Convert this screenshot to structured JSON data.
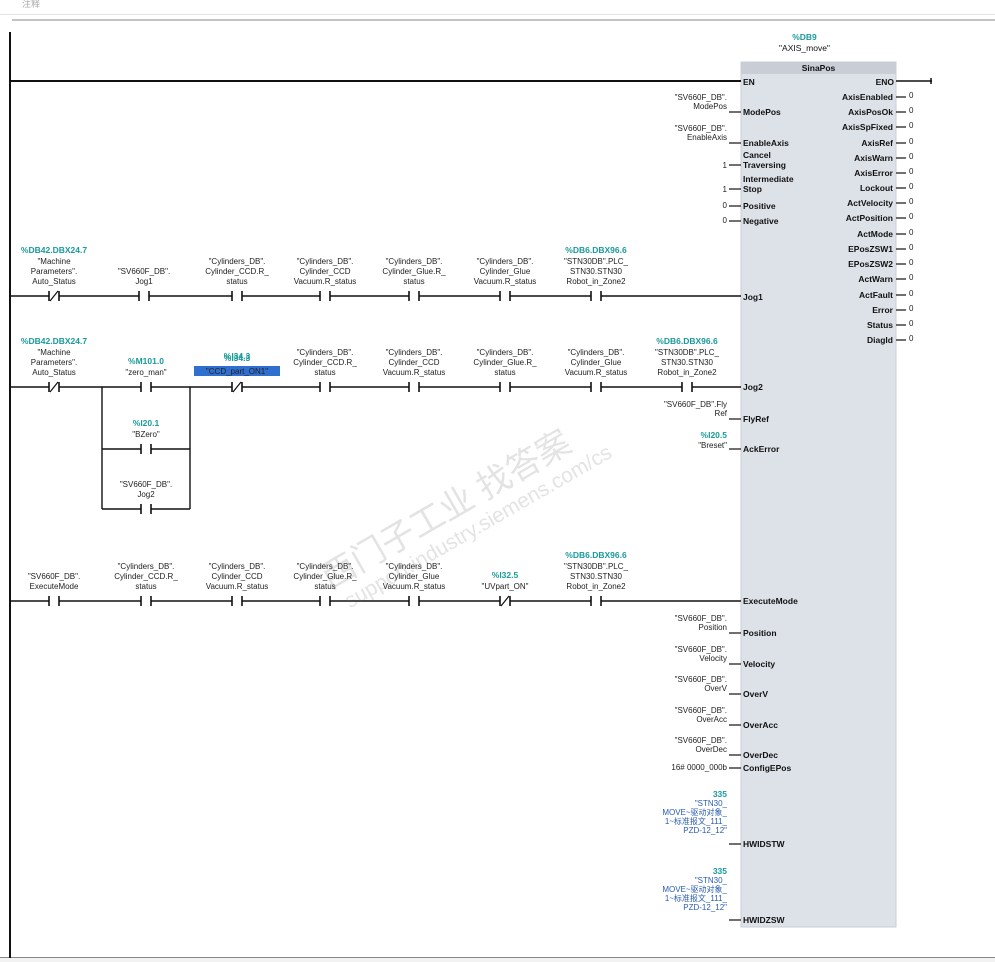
{
  "header": {
    "comment_label": "注释"
  },
  "block": {
    "db_address": "%DB9",
    "db_name": "\"AXIS_move\"",
    "type": "SinaPos",
    "en": "EN",
    "eno": "ENO",
    "left_pins": [
      "ModePos",
      "EnableAxis",
      "Cancel",
      "Traversing",
      "Intermediate",
      "Stop",
      "Positive",
      "Negative",
      "Jog1",
      "Jog2",
      "FlyRef",
      "AckError",
      "ExecuteMode",
      "Position",
      "Velocity",
      "OverV",
      "OverAcc",
      "OverDec",
      "ConfigEPos",
      "HWIDSTW",
      "HWIDZSW"
    ],
    "right_pins": [
      "AxisEnabled",
      "AxisPosOk",
      "AxisSpFixed",
      "AxisRef",
      "AxisWarn",
      "AxisError",
      "Lockout",
      "ActVelocity",
      "ActPosition",
      "ActMode",
      "EPosZSW1",
      "EPosZSW2",
      "ActWarn",
      "ActFault",
      "Error",
      "Status",
      "DiagId"
    ],
    "right_values": [
      "0",
      "0",
      "0",
      "0",
      "0",
      "0",
      "0",
      "0",
      "0",
      "0",
      "0",
      "0",
      "0",
      "0",
      "0",
      "0",
      "0"
    ]
  },
  "inputs": {
    "modepos": [
      "\"SV660F_DB\".",
      "ModePos"
    ],
    "enableaxis": [
      "\"SV660F_DB\".",
      "EnableAxis"
    ],
    "cancel_val": "1",
    "stop_val": "1",
    "positive_val": "0",
    "negative_val": "0",
    "flyref": [
      "\"SV660F_DB\".Fly",
      "Ref"
    ],
    "ackerror_addr": "%I20.5",
    "ackerror_name": "\"Breset\"",
    "position": [
      "\"SV660F_DB\".",
      "Position"
    ],
    "velocity": [
      "\"SV660F_DB\".",
      "Velocity"
    ],
    "overv": [
      "\"SV660F_DB\".",
      "OverV"
    ],
    "overacc": [
      "\"SV660F_DB\".",
      "OverAcc"
    ],
    "overdec": [
      "\"SV660F_DB\".",
      "OverDec"
    ],
    "configepos": "16# 0000_000b",
    "hwidstw": [
      "335",
      "\"STN30_",
      "MOVE~驱动对象_",
      "1~标准报文_111_",
      "PZD-12_12\""
    ],
    "hwidzsw": [
      "335",
      "\"STN30_",
      "MOVE~驱动对象_",
      "1~标准报文_111_",
      "PZD-12_12\""
    ]
  },
  "rung_jog1": [
    {
      "addr": "%DB42.DBX24.7",
      "lines": [
        "\"Machine",
        "Parameters\".",
        "Auto_Status"
      ],
      "type": "NC"
    },
    {
      "addr": "",
      "lines": [
        "\"SV660F_DB\".",
        "Jog1"
      ],
      "type": "NO"
    },
    {
      "addr": "",
      "lines": [
        "\"Cylinders_DB\".",
        "Cylinder_CCD.R_",
        "status"
      ],
      "type": "NO"
    },
    {
      "addr": "",
      "lines": [
        "\"Cylinders_DB\".",
        "Cylinder_CCD",
        "Vacuum.R_status"
      ],
      "type": "NO"
    },
    {
      "addr": "",
      "lines": [
        "\"Cylinders_DB\".",
        "Cylinder_Glue.R_",
        "status"
      ],
      "type": "NO"
    },
    {
      "addr": "",
      "lines": [
        "\"Cylinders_DB\".",
        "Cylinder_Glue",
        "Vacuum.R_status"
      ],
      "type": "NO"
    },
    {
      "addr": "%DB6.DBX96.6",
      "lines": [
        "\"STN30DB\".PLC_",
        "STN30.STN30",
        "Robot_in_Zone2"
      ],
      "type": "NO"
    }
  ],
  "rung_jog2": [
    {
      "addr": "%DB42.DBX24.7",
      "lines": [
        "\"Machine",
        "Parameters\".",
        "Auto_Status"
      ],
      "type": "NC"
    },
    {
      "addr": "%M101.0",
      "lines": [
        "\"zero_man\""
      ],
      "type": "NO"
    },
    {
      "addr": "%I34.3",
      "lines": [
        "\"CCD_part_ON1\""
      ],
      "type": "NC"
    },
    {
      "addr": "",
      "lines": [
        "\"Cylinders_DB\".",
        "Cylinder_CCD.R_",
        "status"
      ],
      "type": "NO"
    },
    {
      "addr": "",
      "lines": [
        "\"Cylinders_DB\".",
        "Cylinder_CCD",
        "Vacuum.R_status"
      ],
      "type": "NO"
    },
    {
      "addr": "",
      "lines": [
        "\"Cylinders_DB\".",
        "Cylinder_Glue.R_",
        "status"
      ],
      "type": "NO"
    },
    {
      "addr": "",
      "lines": [
        "\"Cylinders_DB\".",
        "Cylinder_Glue",
        "Vacuum.R_status"
      ],
      "type": "NO"
    },
    {
      "addr": "%DB6.DBX96.6",
      "lines": [
        "\"STN30DB\".PLC_",
        "STN30.STN30",
        "Robot_in_Zone2"
      ],
      "type": "NO"
    }
  ],
  "jog2_branch": [
    {
      "addr": "%I20.1",
      "lines": [
        "\"BZero\""
      ],
      "type": "NO"
    },
    {
      "addr": "",
      "lines": [
        "\"SV660F_DB\".",
        "Jog2"
      ],
      "type": "NO"
    }
  ],
  "rung_exec": [
    {
      "addr": "",
      "lines": [
        "\"SV660F_DB\".",
        "ExecuteMode"
      ],
      "type": "NO"
    },
    {
      "addr": "",
      "lines": [
        "\"Cylinders_DB\".",
        "Cylinder_CCD.R_",
        "status"
      ],
      "type": "NO"
    },
    {
      "addr": "",
      "lines": [
        "\"Cylinders_DB\".",
        "Cylinder_CCD",
        "Vacuum.R_status"
      ],
      "type": "NO"
    },
    {
      "addr": "",
      "lines": [
        "\"Cylinders_DB\".",
        "Cylinder_Glue.R_",
        "status"
      ],
      "type": "NO"
    },
    {
      "addr": "",
      "lines": [
        "\"Cylinders_DB\".",
        "Cylinder_Glue",
        "Vacuum.R_status"
      ],
      "type": "NO"
    },
    {
      "addr": "%I32.5",
      "lines": [
        "\"UVpart_ON\""
      ],
      "type": "NC"
    },
    {
      "addr": "%DB6.DBX96.6",
      "lines": [
        "\"STN30DB\".PLC_",
        "STN30.STN30",
        "Robot_in_Zone2"
      ],
      "type": "NO"
    }
  ],
  "watermark": [
    "西门子工业 找答案",
    "support.industry.siemens.com/cs"
  ]
}
